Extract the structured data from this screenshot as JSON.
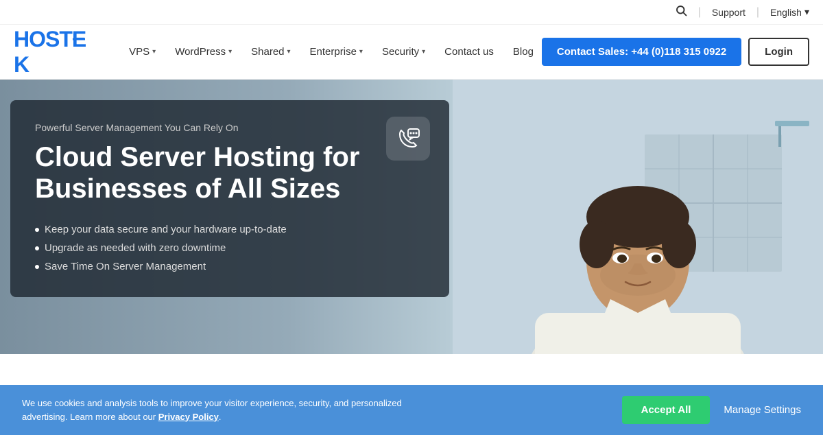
{
  "topbar": {
    "support_label": "Support",
    "language_label": "English",
    "chevron": "▾",
    "divider": "|"
  },
  "navbar": {
    "logo": "HOSTEK",
    "items": [
      {
        "label": "VPS",
        "has_dropdown": true
      },
      {
        "label": "WordPress",
        "has_dropdown": true
      },
      {
        "label": "Shared",
        "has_dropdown": true
      },
      {
        "label": "Enterprise",
        "has_dropdown": true
      },
      {
        "label": "Security",
        "has_dropdown": true
      },
      {
        "label": "Contact us",
        "has_dropdown": false
      },
      {
        "label": "Blog",
        "has_dropdown": false
      }
    ],
    "cta_label": "Contact Sales: +44 (0)118 315 0922",
    "login_label": "Login"
  },
  "hero": {
    "subtitle": "Powerful Server Management You Can Rely On",
    "title": "Cloud Server Hosting for Businesses of All Sizes",
    "features": [
      "Keep your data secure and your hardware up-to-date",
      "Upgrade as needed with zero downtime",
      "Save Time On Server Management"
    ],
    "phone_icon": "📞"
  },
  "cookie": {
    "text": "We use cookies and analysis tools to improve your visitor experience, security, and personalized advertising. Learn more about our ",
    "privacy_link": "Privacy Policy",
    "period": ".",
    "accept_label": "Accept All",
    "manage_label": "Manage Settings"
  }
}
